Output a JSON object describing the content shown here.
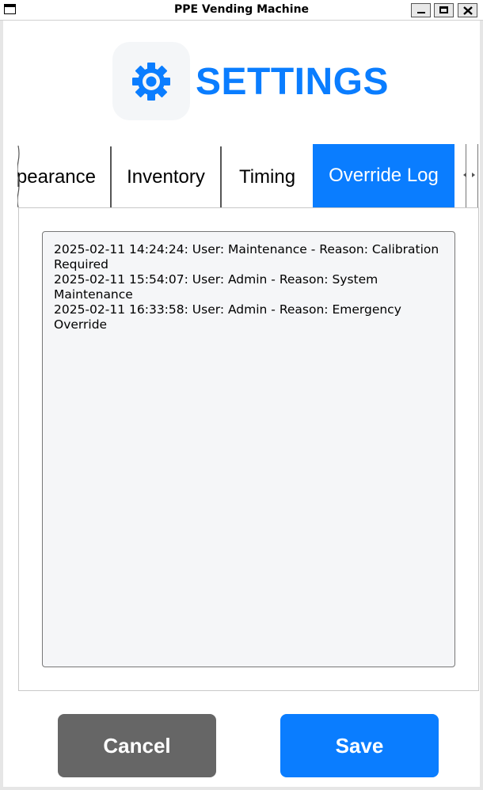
{
  "window": {
    "title": "PPE Vending Machine",
    "controls": [
      "minimize-icon",
      "maximize-icon",
      "close-icon"
    ]
  },
  "header": {
    "icon": "gear-icon",
    "title": "SETTINGS"
  },
  "tabs": [
    {
      "label": "pearance",
      "selected": false
    },
    {
      "label": "Inventory",
      "selected": false
    },
    {
      "label": "Timing",
      "selected": false
    },
    {
      "label": "Override Log",
      "selected": true
    }
  ],
  "override_log": {
    "entries": [
      "2025-02-11 14:24:24: User: Maintenance - Reason: Calibration Required",
      "2025-02-11 15:54:07: User: Admin - Reason: System Maintenance",
      "2025-02-11 16:33:58: User: Admin - Reason: Emergency Override"
    ]
  },
  "actions": {
    "cancel_label": "Cancel",
    "save_label": "Save"
  },
  "colors": {
    "accent": "#0a7dff",
    "cancel": "#666666",
    "log_background": "#f5f6f8"
  }
}
